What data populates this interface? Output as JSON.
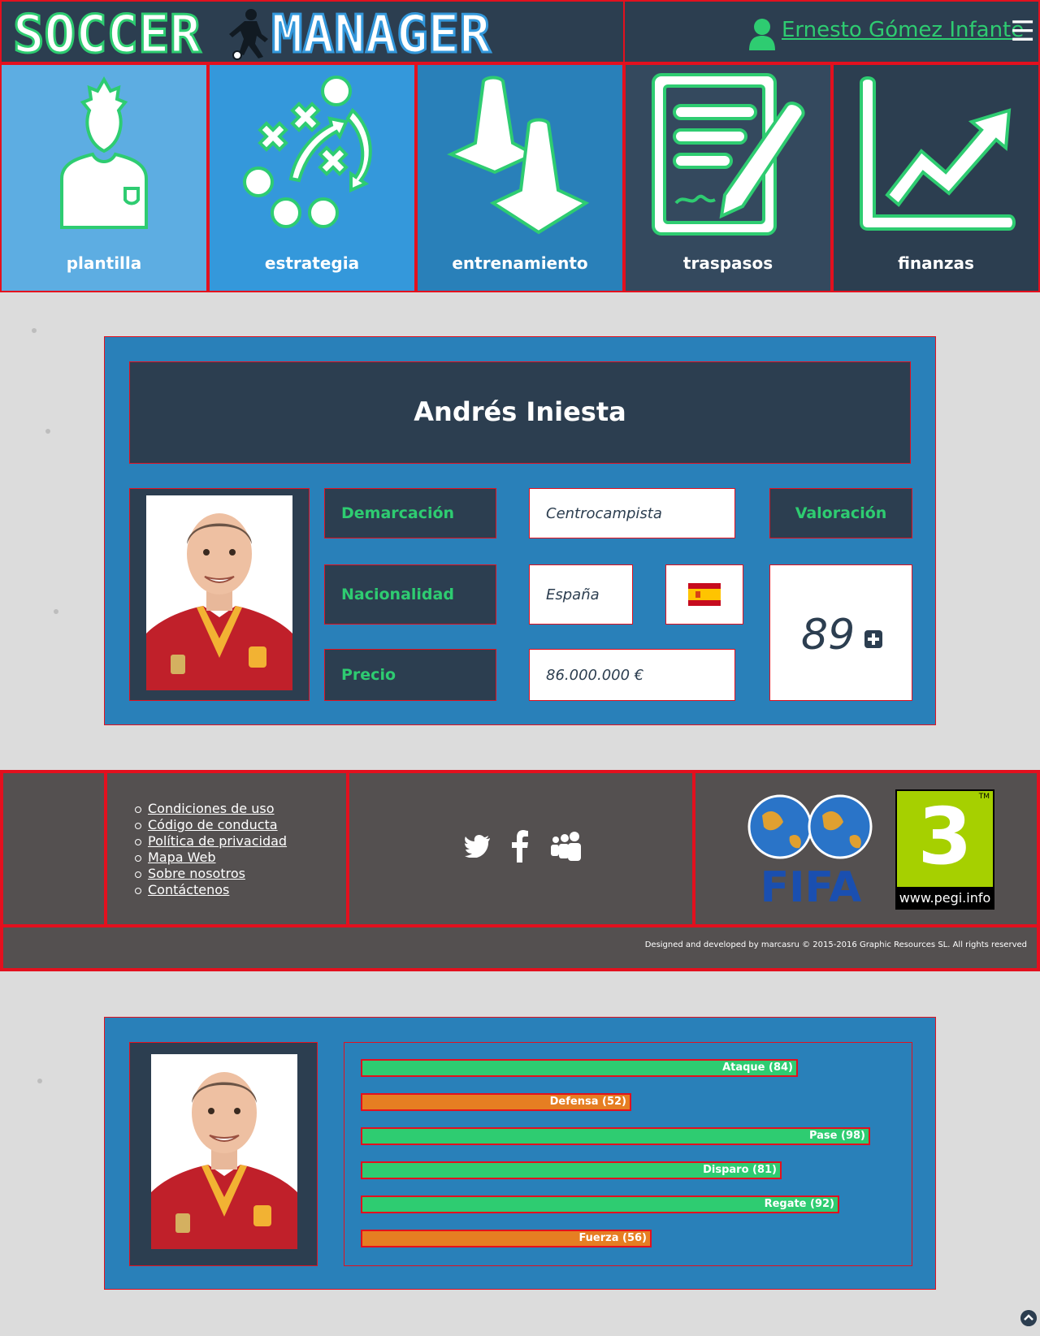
{
  "header": {
    "logo_text_left": "SOCCER",
    "logo_text_right": "MANAGER",
    "user_name": "Ernesto Gómez Infante ",
    "menu_icon": "☰"
  },
  "nav": {
    "tiles": [
      {
        "label": "plantilla",
        "icon": "player-icon",
        "color": "#5dade2"
      },
      {
        "label": "estrategia",
        "icon": "tactics-icon",
        "color": "#3498db"
      },
      {
        "label": "entrenamiento",
        "icon": "cones-icon",
        "color": "#2980b9"
      },
      {
        "label": "traspasos",
        "icon": "contract-icon",
        "color": "#34495e"
      },
      {
        "label": "finanzas",
        "icon": "chart-icon",
        "color": "#2c3e50"
      }
    ]
  },
  "player": {
    "name": "Andrés Iniesta",
    "position_label": "Demarcación",
    "position_value": "Centrocampista",
    "nationality_label": "Nacionalidad",
    "nationality_value": "España",
    "price_label": "Precio",
    "price_value": "86.000.000 €",
    "rating_label": "Valoración",
    "rating_value": "89"
  },
  "footer": {
    "links": [
      "Condiciones de uso",
      "Código de conducta",
      "Política de privacidad",
      "Mapa Web",
      "Sobre nosotros",
      "Contáctenos"
    ],
    "social_icons": [
      "twitter-icon",
      "facebook-icon",
      "myspace-icon"
    ],
    "fifa_text": "FIFA",
    "pegi_number": "3",
    "pegi_tm": "TM",
    "pegi_url": "www.pegi.info",
    "credits": "Designed and developed by marcasru © 2015-2016 Graphic Resources SL. All rights reserved"
  },
  "stats": {
    "bars": [
      {
        "label": "Ataque (84)",
        "value": 84,
        "color": "#2ecc71"
      },
      {
        "label": "Defensa (52)",
        "value": 52,
        "color": "#e67e22"
      },
      {
        "label": "Pase (98)",
        "value": 98,
        "color": "#2ecc71"
      },
      {
        "label": "Disparo (81)",
        "value": 81,
        "color": "#2ecc71"
      },
      {
        "label": "Regate (92)",
        "value": 92,
        "color": "#2ecc71"
      },
      {
        "label": "Fuerza (56)",
        "value": 56,
        "color": "#e67e22"
      }
    ]
  },
  "colors": {
    "accent_green": "#2ecc71",
    "dark_blue": "#2c3e50",
    "border_red": "#e3101e"
  }
}
